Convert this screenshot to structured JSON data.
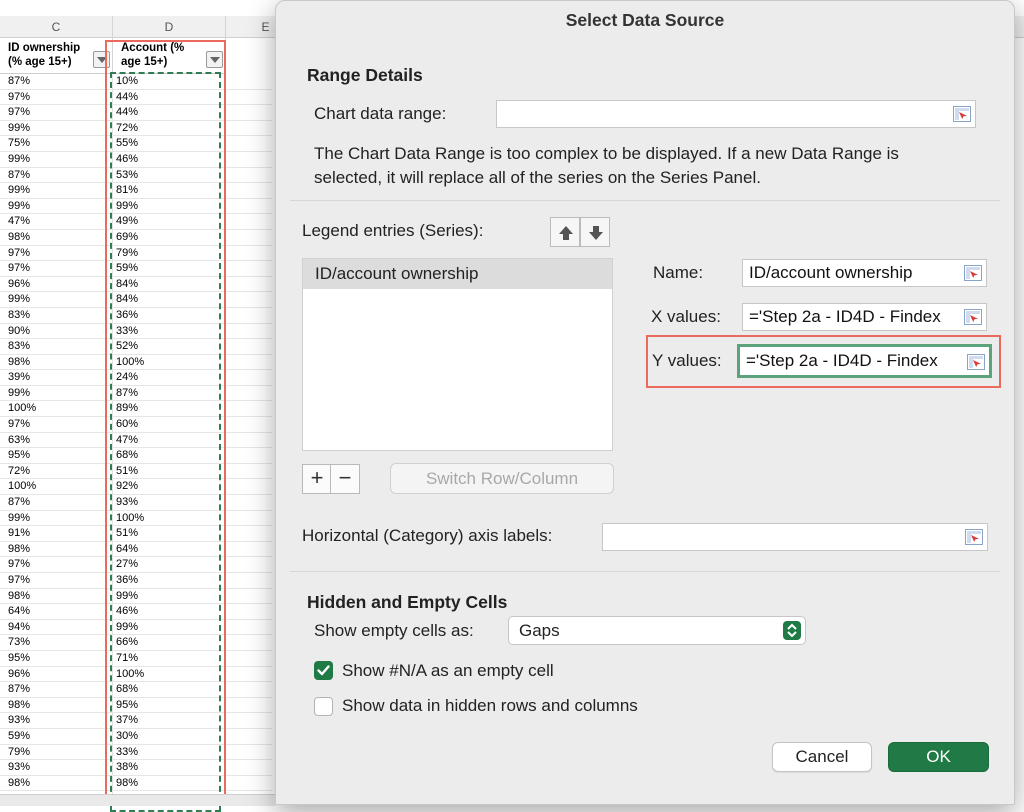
{
  "sheet": {
    "col_headers": [
      "C",
      "D",
      "E"
    ],
    "header_c": "ID ownership (% age 15+)",
    "header_d": "Account (% age 15+)",
    "col_c": [
      "87%",
      "97%",
      "97%",
      "99%",
      "75%",
      "99%",
      "87%",
      "99%",
      "99%",
      "47%",
      "98%",
      "97%",
      "97%",
      "96%",
      "99%",
      "83%",
      "90%",
      "83%",
      "98%",
      "39%",
      "99%",
      "100%",
      "97%",
      "63%",
      "95%",
      "72%",
      "100%",
      "87%",
      "99%",
      "91%",
      "98%",
      "97%",
      "97%",
      "98%",
      "64%",
      "94%",
      "73%",
      "95%",
      "96%",
      "87%",
      "98%",
      "93%",
      "59%",
      "79%",
      "93%",
      "98%"
    ],
    "col_d": [
      "10%",
      "44%",
      "44%",
      "72%",
      "55%",
      "46%",
      "53%",
      "81%",
      "99%",
      "49%",
      "69%",
      "79%",
      "59%",
      "84%",
      "84%",
      "36%",
      "33%",
      "52%",
      "100%",
      "24%",
      "87%",
      "89%",
      "60%",
      "47%",
      "68%",
      "51%",
      "92%",
      "93%",
      "100%",
      "51%",
      "64%",
      "27%",
      "36%",
      "99%",
      "46%",
      "99%",
      "66%",
      "71%",
      "100%",
      "68%",
      "95%",
      "37%",
      "30%",
      "33%",
      "38%",
      "98%"
    ]
  },
  "dialog": {
    "title": "Select Data Source",
    "range_details_title": "Range Details",
    "chart_data_range_label": "Chart data range:",
    "chart_data_range_value": "",
    "range_note": "The Chart Data Range is too complex to be displayed. If a new Data Range is selected, it will replace all of the series on the Series Panel.",
    "legend_entries_label": "Legend entries (Series):",
    "series": [
      "ID/account ownership"
    ],
    "name_label": "Name:",
    "name_value": "ID/account ownership",
    "x_values_label": "X values:",
    "x_values_value": "='Step 2a - ID4D - Findex",
    "y_values_label": "Y values:",
    "y_values_value": "='Step 2a - ID4D - Findex",
    "add_label": "+",
    "remove_label": "−",
    "switch_label": "Switch Row/Column",
    "horizontal_axis_label": "Horizontal (Category) axis labels:",
    "horizontal_axis_value": "",
    "hidden_empty_title": "Hidden and Empty Cells",
    "show_empty_label": "Show empty cells as:",
    "show_empty_value": "Gaps",
    "show_na_label": "Show #N/A as an empty cell",
    "show_na_checked": true,
    "show_hidden_label": "Show data in hidden rows and columns",
    "show_hidden_checked": false,
    "cancel_label": "Cancel",
    "ok_label": "OK"
  },
  "icons": {
    "range_picker": "range-picker-icon",
    "move_up": "arrow-up-icon",
    "move_down": "arrow-down-icon",
    "stepper": "chevron-up-down-icon",
    "filter": "filter-dropdown-icon"
  },
  "colors": {
    "accent_green": "#1f7a45",
    "highlight_red": "#ec6a5c",
    "marching_ants": "#2f7d52"
  }
}
